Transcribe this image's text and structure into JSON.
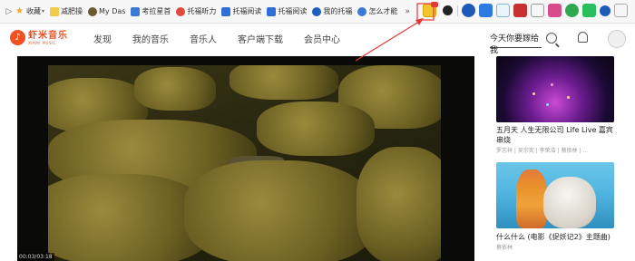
{
  "bookmarks": {
    "items": [
      {
        "label": "收藏",
        "icon": "star-icon"
      },
      {
        "label": "减肥操",
        "icon": "folder-icon"
      },
      {
        "label": "My Das",
        "icon": "site-icon"
      },
      {
        "label": "考拉星首",
        "icon": "site-icon"
      },
      {
        "label": "托福听力",
        "icon": "site-icon"
      },
      {
        "label": "托福阅读",
        "icon": "site-icon"
      },
      {
        "label": "托福阅读",
        "icon": "site-icon"
      },
      {
        "label": "我的托福",
        "icon": "site-icon"
      },
      {
        "label": "怎么才能",
        "icon": "site-icon"
      }
    ],
    "more": "»"
  },
  "site": {
    "logo_cn": "虾米音乐",
    "logo_en": "XIAMI MUSIC",
    "nav": [
      "发现",
      "我的音乐",
      "音乐人",
      "客户端下载",
      "会员中心"
    ],
    "search_placeholder": "今天你要嫁给我"
  },
  "player": {
    "time": "00:03/03:18"
  },
  "side": {
    "items": [
      {
        "title": "五月天 人生无限公司 Life Live 嘉宾串烧",
        "artist": "罗志祥 | 吴宗宪 | 李荣浩 | 蔡依林 | ..."
      },
      {
        "title": "什么什么 (电影《捉妖记2》主题曲)",
        "artist": "蔡依林"
      }
    ]
  },
  "colors": {
    "brand": "#f05123",
    "annotation": "#e53935"
  }
}
